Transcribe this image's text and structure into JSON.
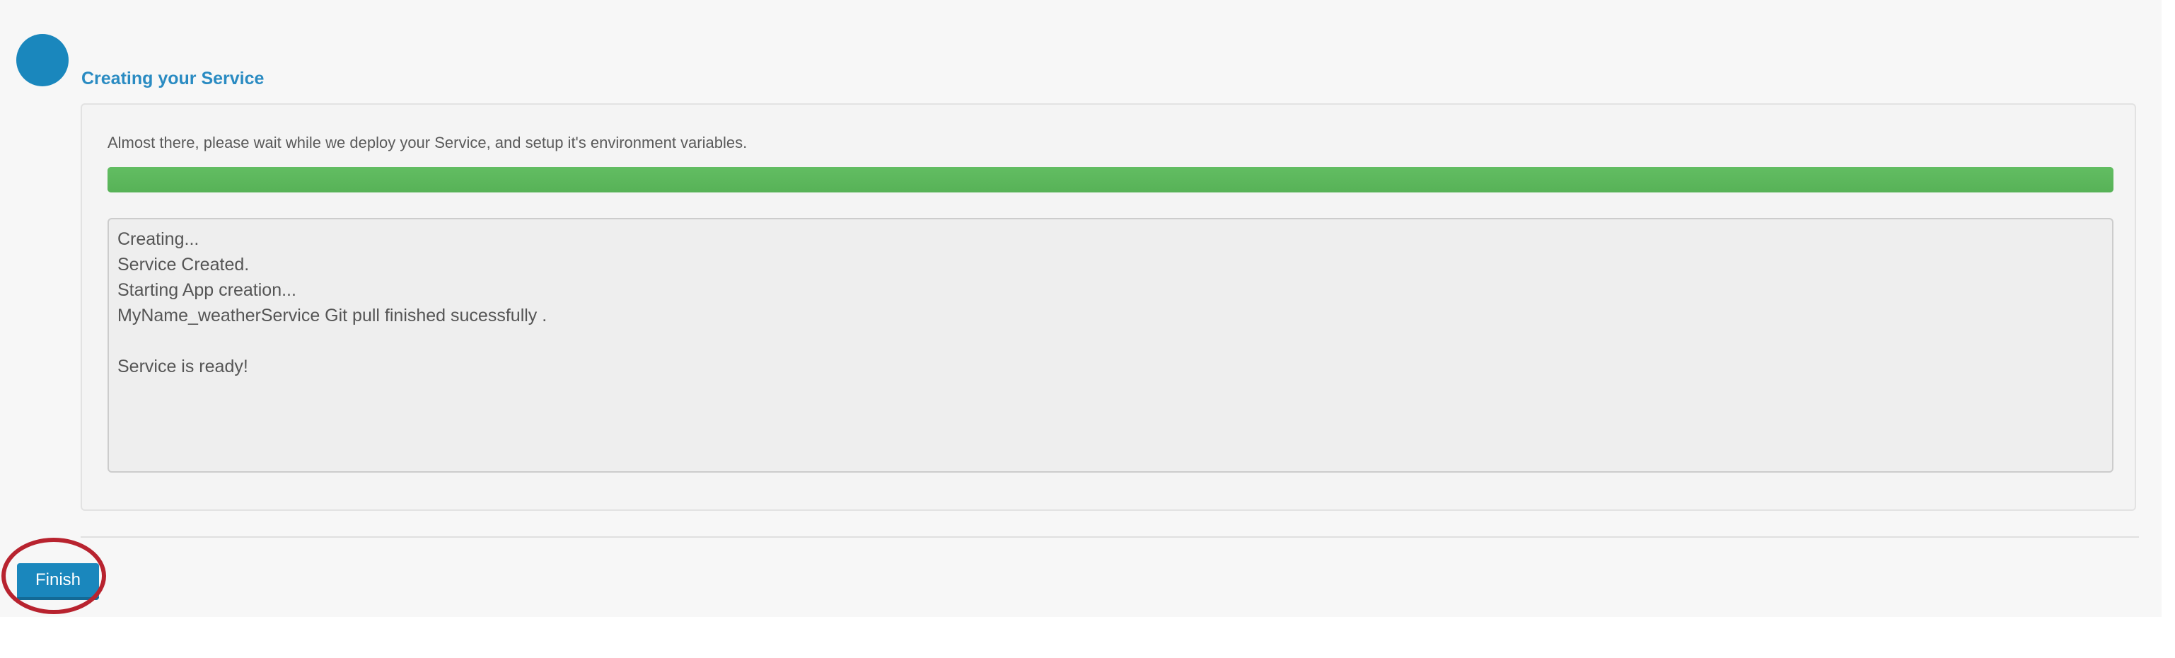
{
  "step": {
    "title": "Creating your Service"
  },
  "main": {
    "description": "Almost there, please wait while we deploy your Service, and setup it's environment variables.",
    "progress": 1.0,
    "progress_color": "#5cb85c",
    "log_lines": [
      "Creating...",
      "Service Created.",
      "Starting App creation...",
      "MyName_weatherService Git pull finished sucessfully .",
      "",
      "Service is ready!"
    ]
  },
  "footer": {
    "finish_label": "Finish"
  },
  "colors": {
    "accent": "#1a87bd",
    "highlight": "#b8232f"
  }
}
